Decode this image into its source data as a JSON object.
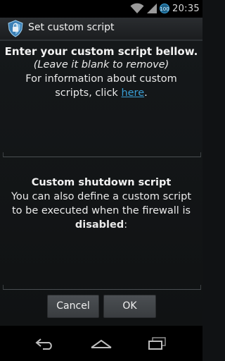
{
  "status_bar": {
    "time": "20:35",
    "battery_level": "100"
  },
  "action_bar": {
    "title": "Set custom script"
  },
  "startup": {
    "line1": "Enter your custom script bellow.",
    "line2": "(Leave it blank to remove)",
    "line3": "For information about custom",
    "line4_prefix": "scripts, click ",
    "link_text": "here",
    "line4_suffix": "."
  },
  "shutdown": {
    "heading": "Custom shutdown script",
    "line1": "You can also define a custom script",
    "line2": "to be executed when the firewall is",
    "bold_word": "disabled",
    "colon": ":"
  },
  "buttons": {
    "cancel": "Cancel",
    "ok": "OK"
  },
  "icons": {
    "wifi": "wifi-icon",
    "signal": "signal-icon",
    "battery": "battery-icon",
    "app": "afwall-shield-icon",
    "back": "back-icon",
    "home": "home-icon",
    "recent": "recent-apps-icon"
  },
  "colors": {
    "link": "#3a9fd6",
    "background": "#101214",
    "button": "#44484b"
  }
}
